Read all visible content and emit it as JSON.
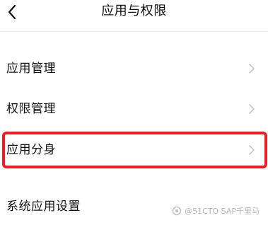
{
  "header": {
    "title": "应用与权限",
    "back_icon": "back-chevron-icon"
  },
  "list": {
    "items": [
      {
        "label": "应用管理",
        "icon": "chevron-right-icon"
      },
      {
        "label": "权限管理",
        "icon": "chevron-right-icon"
      },
      {
        "label": "应用分身",
        "icon": "chevron-right-icon",
        "highlighted": true
      },
      {
        "label": "系统应用设置",
        "icon": "chevron-right-icon"
      }
    ]
  },
  "watermark": {
    "text": "@51CTO SAP千里马"
  },
  "colors": {
    "highlight": "#ee1d24",
    "chevron": "#c6c6c6",
    "text": "#111111",
    "background": "#ffffff"
  }
}
